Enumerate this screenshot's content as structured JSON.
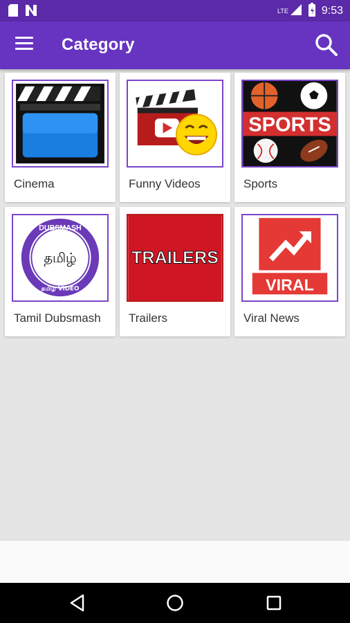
{
  "status_bar": {
    "time": "9:53",
    "network": "LTE",
    "icons": [
      "sd-card-icon",
      "n-notification-icon",
      "signal-icon",
      "battery-icon"
    ]
  },
  "app_bar": {
    "title": "Category",
    "menu_icon": "menu-icon",
    "search_icon": "search-icon",
    "background": "#6634c0",
    "status_background": "#5b2aa8"
  },
  "categories": [
    {
      "label": "Cinema",
      "icon": "clapperboard-icon"
    },
    {
      "label": "Funny Videos",
      "icon": "funny-clapper-icon"
    },
    {
      "label": "Sports",
      "icon": "sports-balls-icon",
      "thumb_text": "SPORTS"
    },
    {
      "label": "Tamil Dubsmash",
      "icon": "dubsmash-seal-icon",
      "thumb_text": "தமிழ்",
      "seal_top": "DUBSMASH",
      "seal_bottom": "தமிழ் VIDEO"
    },
    {
      "label": "Trailers",
      "icon": "trailers-icon",
      "thumb_text": "TRAILERS"
    },
    {
      "label": "Viral News",
      "icon": "viral-arrow-icon",
      "thumb_text": "VIRAL"
    }
  ],
  "nav_bar": {
    "icons": [
      "back-icon",
      "home-icon",
      "recents-icon"
    ]
  }
}
